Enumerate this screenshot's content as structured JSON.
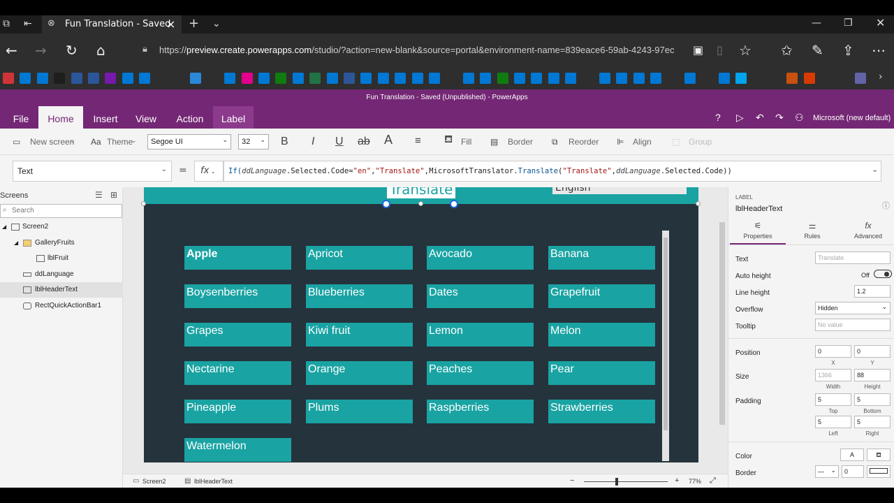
{
  "browser": {
    "tab_title": "Fun Translation - Saved",
    "url_prefix": "https://",
    "url_host": "preview.create.powerapps.com",
    "url_rest": "/studio/?action=new-blank&source=portal&environment-name=839eace6-59ab-4243-97ec"
  },
  "app": {
    "title": "Fun Translation - Saved (Unpublished) - PowerApps",
    "user": "Microsoft (new default)"
  },
  "ribbon": {
    "tabs": [
      "File",
      "Home",
      "Insert",
      "View",
      "Action",
      "Label"
    ],
    "active": "Home"
  },
  "toolbar": {
    "new_screen": "New screen",
    "theme": "Theme",
    "font": "Segoe UI",
    "font_size": "32",
    "fill": "Fill",
    "border": "Border",
    "reorder": "Reorder",
    "align": "Align",
    "group": "Group"
  },
  "formula": {
    "property": "Text",
    "equals": "=",
    "fx": "fx",
    "expr": {
      "p1": "If(",
      "v1": "ddLanguage",
      "p2": ".Selected.Code=",
      "s1": "\"en\"",
      "p3": ",",
      "s2": "\"Translate\"",
      "p4": ",",
      "f1": "MicrosoftTranslator",
      "p5": ".",
      "f2": "Translate",
      "p6": "(",
      "s3": "\"Translate\"",
      "p7": ",",
      "v2": "ddLanguage",
      "p8": ".Selected.Code))"
    }
  },
  "tree": {
    "header": "Screens",
    "search_placeholder": "Search",
    "items": [
      {
        "label": "Screen2"
      },
      {
        "label": "GalleryFruits"
      },
      {
        "label": "lblFruit"
      },
      {
        "label": "ddLanguage"
      },
      {
        "label": "lblHeaderText"
      },
      {
        "label": "RectQuickActionBar1"
      }
    ]
  },
  "canvas": {
    "header_label": "Translate",
    "language": "English",
    "fruits": [
      "Apple",
      "Apricot",
      "Avocado",
      "Banana",
      "Boysenberries",
      "Blueberries",
      "Dates",
      "Grapefruit",
      "Grapes",
      "Kiwi fruit",
      "Lemon",
      "Melon",
      "Nectarine",
      "Orange",
      "Peaches",
      "Pear",
      "Pineapple",
      "Plums",
      "Raspberries",
      "Strawberries",
      "Watermelon"
    ]
  },
  "props": {
    "type": "LABEL",
    "name": "lblHeaderText",
    "tabs": [
      "Properties",
      "Rules",
      "Advanced"
    ],
    "text_label": "Text",
    "text_value": "Translate",
    "auto_height_label": "Auto height",
    "auto_height_value": "Off",
    "line_height_label": "Line height",
    "line_height_value": "1.2",
    "overflow_label": "Overflow",
    "overflow_value": "Hidden",
    "tooltip_label": "Tooltip",
    "tooltip_placeholder": "No value",
    "position_label": "Position",
    "pos_x": "0",
    "pos_y": "0",
    "x_cap": "X",
    "y_cap": "Y",
    "size_label": "Size",
    "width": "1366",
    "height": "88",
    "width_cap": "Width",
    "height_cap": "Height",
    "padding_label": "Padding",
    "pad_top": "5",
    "pad_bottom": "5",
    "pad_left": "5",
    "pad_right": "5",
    "top_cap": "Top",
    "bottom_cap": "Bottom",
    "left_cap": "Left",
    "right_cap": "Right",
    "color_label": "Color",
    "color_a": "A",
    "border_label": "Border",
    "border_value": "0"
  },
  "status": {
    "screen": "Screen2",
    "control": "lblHeaderText",
    "zoom": "77%"
  },
  "colors": {
    "brand": "#742774",
    "tile": "#1aa3a3",
    "screen_bg": "#25333c"
  }
}
